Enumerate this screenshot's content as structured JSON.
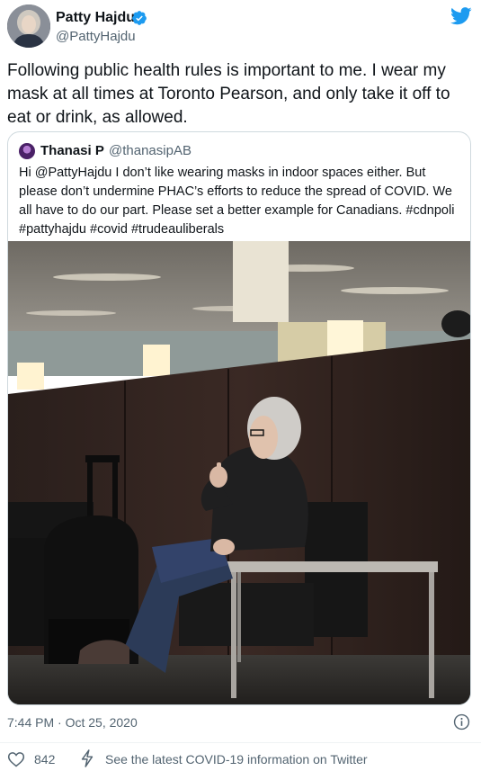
{
  "author": {
    "name": "Patty Hajdu",
    "handle": "@PattyHajdu",
    "verified": true
  },
  "tweet": {
    "text": "Following public health rules is important to me. I wear my mask at all times at Toronto Pearson, and only take it off to eat or drink, as allowed."
  },
  "quoted_tweet": {
    "name": "Thanasi P",
    "handle": "@thanasipAB",
    "text": "Hi @PattyHajdu I don’t like wearing masks in indoor spaces either. But please don’t undermine PHAC’s efforts to reduce the spread of COVID. We all have to do our part.  Please set a better example for Canadians. #cdnpoli #pattyhajdu #covid #trudeauliberals"
  },
  "footer": {
    "timestamp": "7:44 PM · Oct 25, 2020",
    "like_count": "842",
    "covid_info": "See the latest COVID-19 information on Twitter"
  },
  "icons": {
    "twitter_logo": "twitter-bird-icon",
    "verified_badge": "verified-badge-icon",
    "info": "info-icon",
    "like": "heart-icon",
    "covid": "lightning-bolt-icon"
  },
  "colors": {
    "twitter_blue": "#1d9bf0",
    "secondary_text": "#536471",
    "primary_text": "#0f1419",
    "border": "#cfd9de"
  }
}
